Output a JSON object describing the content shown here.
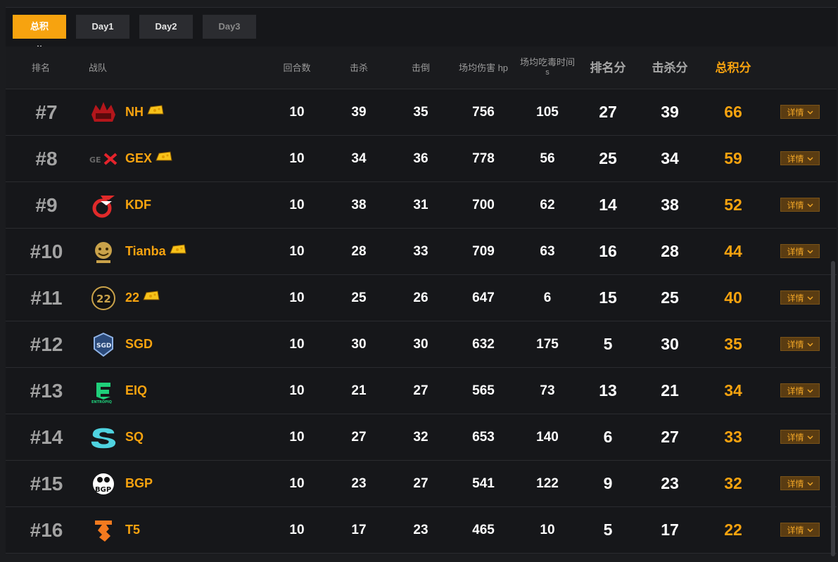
{
  "tabs": [
    {
      "label": "总积分",
      "active": true
    },
    {
      "label": "Day1",
      "active": false
    },
    {
      "label": "Day2",
      "active": false
    },
    {
      "label": "Day3",
      "active": false
    }
  ],
  "headers": {
    "rank": "排名",
    "team": "战队",
    "rounds": "回合数",
    "kills": "击杀",
    "knocks": "击倒",
    "avg_dmg": "场均伤害 hp",
    "avg_chicken": "场均吃毒时间",
    "avg_chicken_unit": "s",
    "rank_pts": "排名分",
    "kill_pts": "击杀分",
    "total": "总积分"
  },
  "detail_label": "详情",
  "rows": [
    {
      "rank": "#7",
      "team": "NH",
      "logo": "nh-logo",
      "tag": true,
      "rounds": "10",
      "kills": "39",
      "knocks": "35",
      "dmg": "756",
      "chicken": "105",
      "rank_pts": "27",
      "kill_pts": "39",
      "total": "66"
    },
    {
      "rank": "#8",
      "team": "GEX",
      "logo": "gex-logo",
      "tag": true,
      "rounds": "10",
      "kills": "34",
      "knocks": "36",
      "dmg": "778",
      "chicken": "56",
      "rank_pts": "25",
      "kill_pts": "34",
      "total": "59"
    },
    {
      "rank": "#9",
      "team": "KDF",
      "logo": "kdf-logo",
      "tag": false,
      "rounds": "10",
      "kills": "38",
      "knocks": "31",
      "dmg": "700",
      "chicken": "62",
      "rank_pts": "14",
      "kill_pts": "38",
      "total": "52"
    },
    {
      "rank": "#10",
      "team": "Tianba",
      "logo": "tianba-logo",
      "tag": true,
      "rounds": "10",
      "kills": "28",
      "knocks": "33",
      "dmg": "709",
      "chicken": "63",
      "rank_pts": "16",
      "kill_pts": "28",
      "total": "44"
    },
    {
      "rank": "#11",
      "team": "22",
      "logo": "22-logo",
      "tag": true,
      "rounds": "10",
      "kills": "25",
      "knocks": "26",
      "dmg": "647",
      "chicken": "6",
      "rank_pts": "15",
      "kill_pts": "25",
      "total": "40"
    },
    {
      "rank": "#12",
      "team": "SGD",
      "logo": "sgd-logo",
      "tag": false,
      "rounds": "10",
      "kills": "30",
      "knocks": "30",
      "dmg": "632",
      "chicken": "175",
      "rank_pts": "5",
      "kill_pts": "30",
      "total": "35"
    },
    {
      "rank": "#13",
      "team": "EIQ",
      "logo": "eiq-logo",
      "tag": false,
      "rounds": "10",
      "kills": "21",
      "knocks": "27",
      "dmg": "565",
      "chicken": "73",
      "rank_pts": "13",
      "kill_pts": "21",
      "total": "34"
    },
    {
      "rank": "#14",
      "team": "SQ",
      "logo": "sq-logo",
      "tag": false,
      "rounds": "10",
      "kills": "27",
      "knocks": "32",
      "dmg": "653",
      "chicken": "140",
      "rank_pts": "6",
      "kill_pts": "27",
      "total": "33"
    },
    {
      "rank": "#15",
      "team": "BGP",
      "logo": "bgp-logo",
      "tag": false,
      "rounds": "10",
      "kills": "23",
      "knocks": "27",
      "dmg": "541",
      "chicken": "122",
      "rank_pts": "9",
      "kill_pts": "23",
      "total": "32"
    },
    {
      "rank": "#16",
      "team": "T5",
      "logo": "t5-logo",
      "tag": false,
      "rounds": "10",
      "kills": "17",
      "knocks": "23",
      "dmg": "465",
      "chicken": "10",
      "rank_pts": "5",
      "kill_pts": "17",
      "total": "22"
    }
  ],
  "colors": {
    "accent": "#f7a30f",
    "bg": "#16171a",
    "detail_bg": "#5a3c12"
  }
}
